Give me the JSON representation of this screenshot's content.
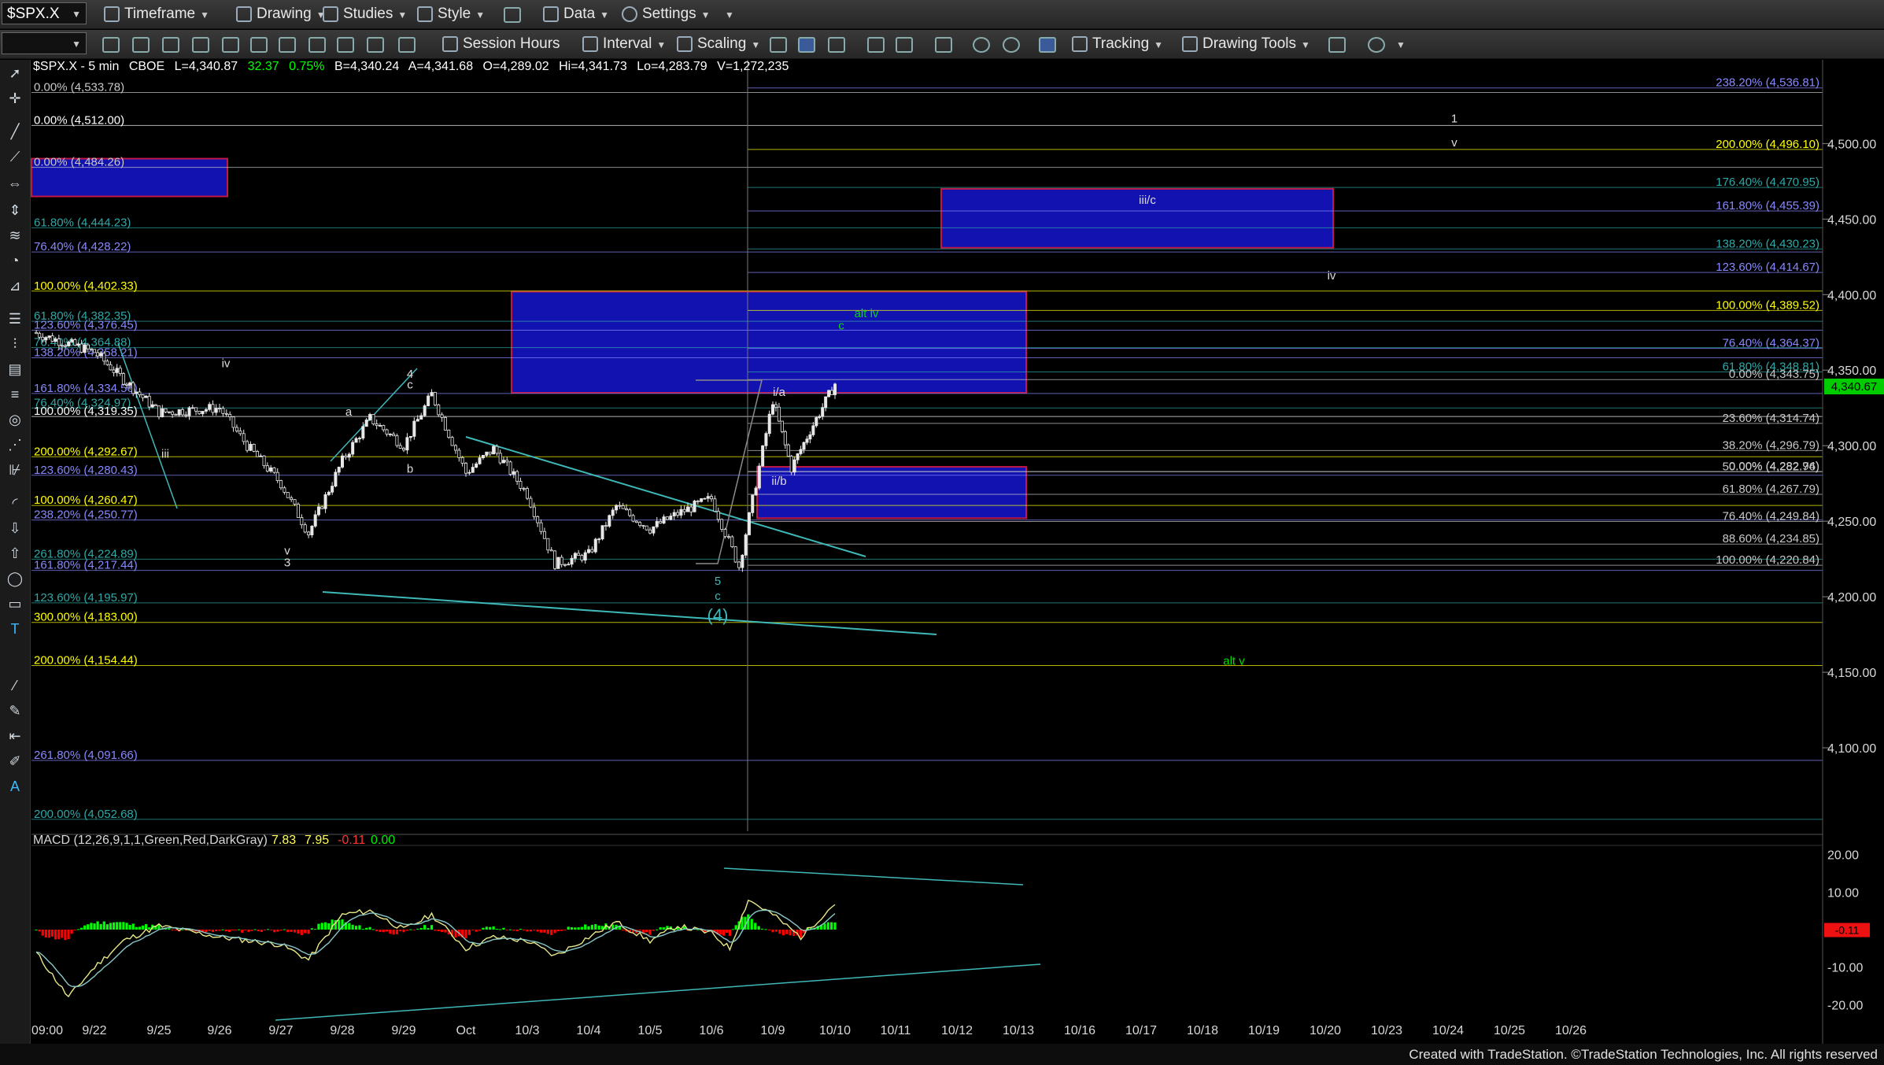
{
  "toolbar1": {
    "symbol": "$SPX.X",
    "timeframe": "Timeframe",
    "drawing": "Drawing",
    "studies": "Studies",
    "style": "Style",
    "data": "Data",
    "settings": "Settings"
  },
  "toolbar2": {
    "session_hours": "Session Hours",
    "interval": "Interval",
    "scaling": "Scaling",
    "tracking": "Tracking",
    "drawing_tools": "Drawing Tools"
  },
  "header": {
    "symbol": "$SPX.X - 5 min",
    "exchange": "CBOE",
    "last": "L=4,340.87",
    "change": "32.37",
    "pct": "0.75%",
    "bid": "B=4,340.24",
    "ask": "A=4,341.68",
    "open": "O=4,289.02",
    "high": "Hi=4,341.73",
    "low": "Lo=4,283.79",
    "volume": "V=1,272,235"
  },
  "price_tag": "4,340.67",
  "footer": "Created with TradeStation. ©TradeStation Technologies, Inc. All rights reserved",
  "colors": {
    "up": "#00ff00",
    "down": "#ff0000",
    "price_line": "#ffffff",
    "boxes": "#1212b0",
    "trendline": "#3fb8b8"
  },
  "chart_data": [
    {
      "type": "candlestick",
      "title": "$SPX.X - 5 min",
      "x_ticks": [
        "09:00",
        "9/22",
        "9/25",
        "9/26",
        "9/27",
        "9/28",
        "9/29",
        "Oct",
        "10/3",
        "10/4",
        "10/5",
        "10/6",
        "10/9",
        "10/10",
        "10/11",
        "10/12",
        "10/13",
        "10/16",
        "10/17",
        "10/18",
        "10/19",
        "10/20",
        "10/23",
        "10/24",
        "10/25",
        "10/26"
      ],
      "y_ticks": [
        4100,
        4150,
        4200,
        4250,
        4300,
        4350,
        4400,
        4450,
        4500
      ],
      "ylim": [
        4050,
        4545
      ],
      "last_price": 4340.67,
      "price_path": [
        [
          "09:00",
          4375
        ],
        [
          "9/22",
          4362
        ],
        [
          "9/25",
          4322
        ],
        [
          "9/26",
          4325
        ],
        [
          "9/26",
          4300
        ],
        [
          "9/27",
          4275
        ],
        [
          "9/27",
          4242
        ],
        [
          "9/28",
          4290
        ],
        [
          "9/28",
          4318
        ],
        [
          "9/29",
          4300
        ],
        [
          "9/29",
          4334
        ],
        [
          "Oct",
          4282
        ],
        [
          "Oct",
          4298
        ],
        [
          "10/3",
          4268
        ],
        [
          "10/3",
          4222
        ],
        [
          "10/4",
          4228
        ],
        [
          "10/4",
          4260
        ],
        [
          "10/5",
          4245
        ],
        [
          "10/5",
          4255
        ],
        [
          "10/6",
          4265
        ],
        [
          "10/6",
          4220
        ],
        [
          "10/9",
          4330
        ],
        [
          "10/9",
          4285
        ],
        [
          "10/9",
          4310
        ],
        [
          "10/10",
          4341
        ]
      ],
      "fib_left": [
        {
          "label": "0.00% (4,533.78)",
          "color": "#c8c8c8"
        },
        {
          "label": "0.00% (4,512.00)",
          "color": "#ffffff"
        },
        {
          "label": "0.00% (4,484.26)",
          "color": "#c8c8c8"
        },
        {
          "label": "61.80% (4,444.23)",
          "color": "#2fa8a8"
        },
        {
          "label": "76.40% (4,428.22)",
          "color": "#8888ff"
        },
        {
          "label": "100.00% (4,402.33)",
          "color": "#ffff00"
        },
        {
          "label": "61.80% (4,382.35)",
          "color": "#2fa8a8"
        },
        {
          "label": "123.60% (4,376.45)",
          "color": "#8888ff"
        },
        {
          "label": "76.40% (4,364.88)",
          "color": "#2fa8a8"
        },
        {
          "label": "138.20% (4,358.21)",
          "color": "#8888ff"
        },
        {
          "label": "161.80% (4,334.56)",
          "color": "#8888ff"
        },
        {
          "label": "76.40% (4,324.97)",
          "color": "#2fa8a8"
        },
        {
          "label": "100.00% (4,319.35)",
          "color": "#ffffff"
        },
        {
          "label": "200.00% (4,292.67)",
          "color": "#ffff00"
        },
        {
          "label": "123.60% (4,280.43)",
          "color": "#8888ff"
        },
        {
          "label": "100.00% (4,260.47)",
          "color": "#ffff00"
        },
        {
          "label": "238.20% (4,250.77)",
          "color": "#8888ff"
        },
        {
          "label": "261.80% (4,224.89)",
          "color": "#2fa8a8"
        },
        {
          "label": "161.80% (4,217.44)",
          "color": "#8888ff"
        },
        {
          "label": "123.60% (4,195.97)",
          "color": "#2fa8a8"
        },
        {
          "label": "300.00% (4,183.00)",
          "color": "#ffff00"
        },
        {
          "label": "200.00% (4,154.44)",
          "color": "#ffff00"
        },
        {
          "label": "261.80% (4,091.66)",
          "color": "#8888ff"
        },
        {
          "label": "200.00% (4,052.68)",
          "color": "#2fa8a8"
        }
      ],
      "fib_right": [
        {
          "label": "238.20% (4,536.81)",
          "color": "#8888ff"
        },
        {
          "label": "200.00% (4,496.10)",
          "color": "#ffff00"
        },
        {
          "label": "176.40% (4,470.95)",
          "color": "#2fa8a8"
        },
        {
          "label": "161.80% (4,455.39)",
          "color": "#8888ff"
        },
        {
          "label": "138.20% (4,430.23)",
          "color": "#2fa8a8"
        },
        {
          "label": "123.60% (4,414.67)",
          "color": "#8888ff"
        },
        {
          "label": "100.00% (4,389.52)",
          "color": "#ffff00"
        },
        {
          "label": "76.40% (4,364.37)",
          "color": "#8888ff"
        },
        {
          "label": "61.80% (4,348.81)",
          "color": "#2fa8a8"
        },
        {
          "label": "0.00% (4,343.75)",
          "color": "#c8c8c8"
        },
        {
          "label": "23.60% (4,314.74)",
          "color": "#c8c8c8"
        },
        {
          "label": "38.20% (4,296.79)",
          "color": "#c8c8c8"
        },
        {
          "label": "0.00% (4,282.94)",
          "color": "#c8c8c8"
        },
        {
          "label": "50.00% (4,282.76)",
          "color": "#c8c8c8"
        },
        {
          "label": "61.80% (4,267.79)",
          "color": "#c8c8c8"
        },
        {
          "label": "76.40% (4,249.84)",
          "color": "#c8c8c8"
        },
        {
          "label": "88.60% (4,234.85)",
          "color": "#c8c8c8"
        },
        {
          "label": "100.00% (4,220.84)",
          "color": "#c8c8c8"
        }
      ],
      "boxes": [
        {
          "x0": "09:00",
          "x1": "9/26",
          "y0": 4465,
          "y1": 4490
        },
        {
          "x0": "10/3",
          "x1": "10/13",
          "y0": 4335,
          "y1": 4402
        },
        {
          "x0": "10/12",
          "x1": "10/20",
          "y0": 4431,
          "y1": 4470
        },
        {
          "x0": "10/9",
          "x1": "10/13",
          "y0": 4252,
          "y1": 4286
        }
      ],
      "wave_labels": [
        {
          "text": "iv",
          "x": "9/26",
          "y": 4352,
          "color": "#dddddd"
        },
        {
          "text": "iii",
          "x": "9/25",
          "y": 4292,
          "color": "#dddddd"
        },
        {
          "text": "v",
          "x": "9/27",
          "y": 4228,
          "color": "#dddddd"
        },
        {
          "text": "3",
          "x": "9/27",
          "y": 4220,
          "color": "#dddddd"
        },
        {
          "text": "a",
          "x": "9/28",
          "y": 4320,
          "color": "#dddddd"
        },
        {
          "text": "b",
          "x": "9/29",
          "y": 4282,
          "color": "#dddddd"
        },
        {
          "text": "4",
          "x": "9/29",
          "y": 4345,
          "color": "#dddddd"
        },
        {
          "text": "c",
          "x": "9/29",
          "y": 4338,
          "color": "#dddddd"
        },
        {
          "text": "5",
          "x": "10/6",
          "y": 4208,
          "color": "#3fb8b8"
        },
        {
          "text": "c",
          "x": "10/6",
          "y": 4198,
          "color": "#3fb8b8"
        },
        {
          "text": "(4)",
          "x": "10/6",
          "y": 4184,
          "color": "#3fb8b8"
        },
        {
          "text": "i/a",
          "x": "10/9",
          "y": 4333,
          "color": "#dddddd"
        },
        {
          "text": "ii/b",
          "x": "10/9",
          "y": 4274,
          "color": "#dddddd"
        },
        {
          "text": "alt iv",
          "x": "10/10",
          "y": 4385,
          "color": "#00dd00"
        },
        {
          "text": "c",
          "x": "10/10",
          "y": 4377,
          "color": "#00dd00"
        },
        {
          "text": "iii/c",
          "x": "10/17",
          "y": 4460,
          "color": "#dddddd"
        },
        {
          "text": "iv",
          "x": "10/20",
          "y": 4410,
          "color": "#dddddd"
        },
        {
          "text": "1",
          "x": "10/24",
          "y": 4514,
          "color": "#dddddd"
        },
        {
          "text": "v",
          "x": "10/24",
          "y": 4498,
          "color": "#dddddd"
        },
        {
          "text": "alt v",
          "x": "10/18",
          "y": 4155,
          "color": "#00dd00"
        }
      ]
    },
    {
      "type": "macd",
      "title": "MACD (12,26,9,1,1,Green,Red,DarkGray)",
      "values": {
        "macd": "7.83",
        "signal": "7.95",
        "diff": "-0.11",
        "zero": "0.00"
      },
      "value_colors": [
        "#ffff55",
        "#ffff55",
        "#ff3333",
        "#00ee00"
      ],
      "y_ticks": [
        20,
        10,
        0,
        -10,
        -20
      ],
      "ylim": [
        -22,
        22
      ],
      "last_value_tag": "-0.11",
      "macd_path": [
        [
          "09:00",
          -5
        ],
        [
          "09:00",
          -18
        ],
        [
          "9/22",
          -10
        ],
        [
          "9/22",
          -3
        ],
        [
          "9/25",
          1
        ],
        [
          "9/26",
          -2
        ],
        [
          "9/27",
          -4
        ],
        [
          "9/27",
          -8
        ],
        [
          "9/28",
          4
        ],
        [
          "9/28",
          5
        ],
        [
          "9/29",
          0
        ],
        [
          "9/29",
          4
        ],
        [
          "Oct",
          -5
        ],
        [
          "Oct",
          -2
        ],
        [
          "10/3",
          -3
        ],
        [
          "10/3",
          -7
        ],
        [
          "10/4",
          -2
        ],
        [
          "10/4",
          2
        ],
        [
          "10/5",
          -3
        ],
        [
          "10/5",
          1
        ],
        [
          "10/6",
          -1
        ],
        [
          "10/6",
          -5
        ],
        [
          "10/6",
          8
        ],
        [
          "10/9",
          4
        ],
        [
          "10/9",
          -2
        ],
        [
          "10/10",
          7
        ]
      ]
    }
  ]
}
